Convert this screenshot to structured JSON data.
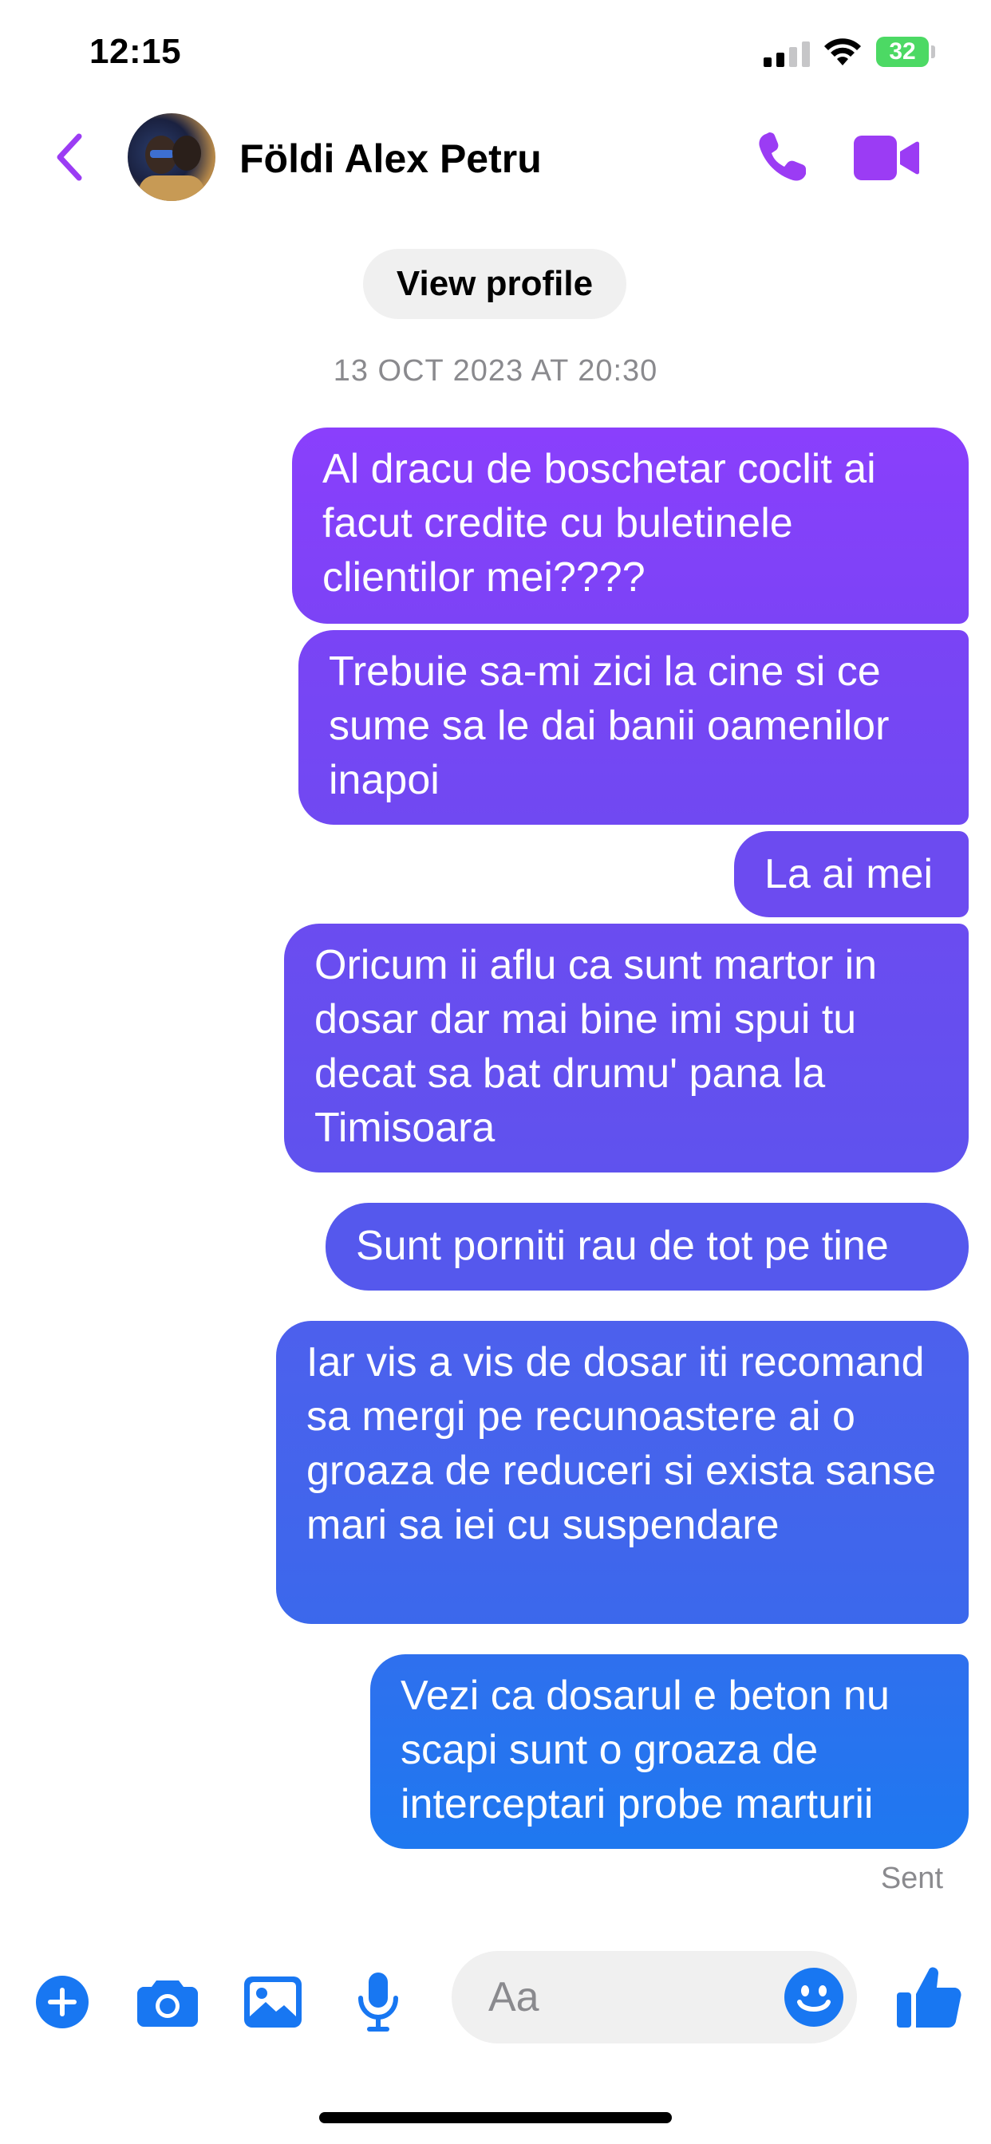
{
  "status_bar": {
    "time": "12:15",
    "battery": "32"
  },
  "header": {
    "contact_name": "Földi Alex Petru",
    "back_icon": "chevron-left-icon",
    "call_icon": "phone-icon",
    "video_icon": "video-camera-icon"
  },
  "conversation": {
    "view_profile_label": "View profile",
    "timestamp": "13 OCT 2023 AT 20:30",
    "messages": [
      {
        "text": "Al dracu de boschetar coclit ai facut credite cu buletinele clientilor mei????"
      },
      {
        "text": "Trebuie sa-mi zici la cine si ce sume sa le dai banii oamenilor inapoi"
      },
      {
        "text": "La ai mei"
      },
      {
        "text": "Oricum ii aflu ca sunt martor in dosar dar mai bine imi spui tu decat sa bat drumu' pana la Timisoara"
      },
      {
        "text": "Sunt porniti rau de tot pe tine"
      },
      {
        "text": "Iar vis a vis de dosar iti recomand sa mergi pe recunoastere ai o groaza de reduceri si exista sanse mari sa iei cu suspendare"
      },
      {
        "text": "Vezi ca dosarul e beton nu scapi sunt o groaza de interceptari probe marturii"
      }
    ],
    "status": "Sent"
  },
  "composer": {
    "placeholder": "Aa",
    "icons": [
      "plus-icon",
      "camera-icon",
      "gallery-icon",
      "microphone-icon",
      "emoji-icon",
      "thumbs-up-icon"
    ]
  },
  "colors": {
    "accent_purple": "#9b3cf4",
    "accent_blue": "#1877f2"
  }
}
